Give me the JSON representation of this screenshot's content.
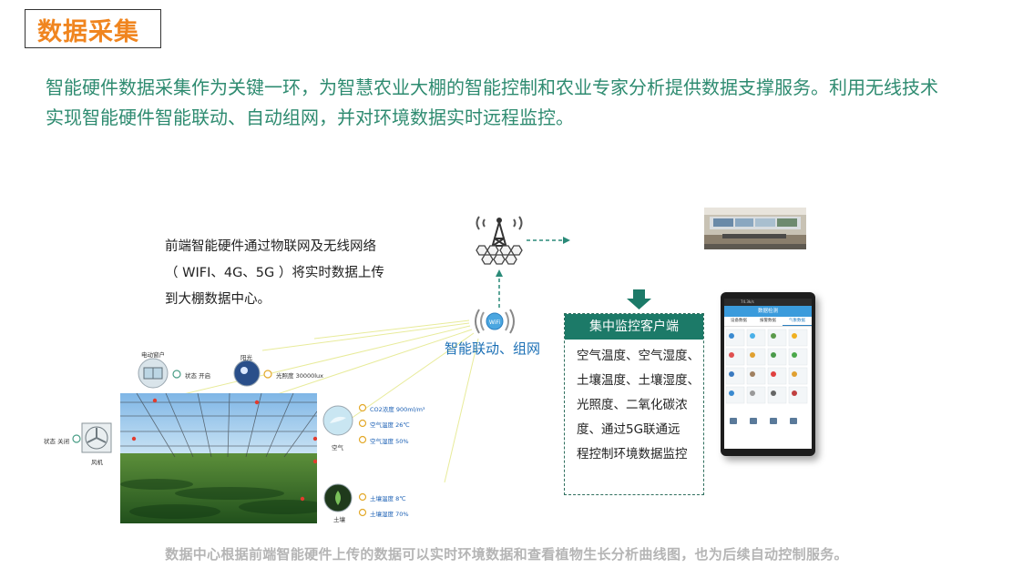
{
  "header": {
    "title": "数据采集",
    "intro": "智能硬件数据采集作为关键一环，为智慧农业大棚的智能控制和农业专家分析提供数据支撑服务。利用无线技术实现智能硬件智能联动、自动组网，并对环境数据实时远程监控。"
  },
  "front_end": {
    "line1": "前端智能硬件通过物联网及无线网络",
    "line2": "（ WIFI、4G、5G ）将实时数据上传",
    "line3": "到大棚数据中心。"
  },
  "network": {
    "label": "智能联动、组网",
    "badge": "WiFi"
  },
  "client": {
    "title": "集中监控客户端",
    "lines": [
      "空气温度、空气湿度、",
      "土壤温度、土壤湿度、",
      "光照度、二氧化碳浓",
      "度、通过5G联通远",
      "程控制环境数据监控"
    ]
  },
  "sensors": {
    "window": {
      "name": "电动窗户",
      "state_label": "状态",
      "state_value": "开启"
    },
    "light": {
      "name": "阳光",
      "reading": "光照度 30000lux"
    },
    "fan": {
      "name": "风机",
      "state": "状态 关闭"
    },
    "air": {
      "name": "空气",
      "co2": "CO2浓度 900ml/m³",
      "temp": "空气温度 26℃",
      "humidity": "空气湿度 50%"
    },
    "soil": {
      "name": "土壤",
      "temp": "土壤温度 8℃",
      "humidity": "土壤湿度 70%"
    }
  },
  "phone": {
    "status": "74.3k/s",
    "title": "数据检测",
    "tabs": [
      "设备数据",
      "报警数据",
      "气象数据"
    ]
  },
  "footer": {
    "text": "数据中心根据前端智能硬件上传的数据可以实时环境数据和查看植物生长分析曲线图，也为后续自动控制服务。"
  },
  "colors": {
    "accent": "#f0851f",
    "intro": "#2e8b70",
    "client_header": "#1c7a68",
    "network_blue": "#1a6fb5"
  }
}
